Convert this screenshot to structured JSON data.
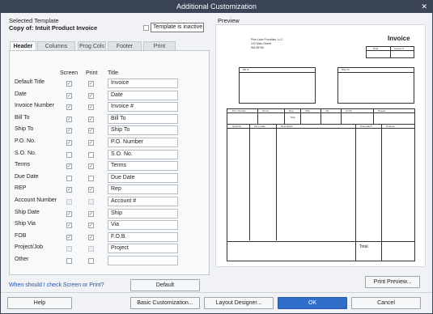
{
  "window": {
    "title": "Additional Customization"
  },
  "template": {
    "selected_label": "Selected Template",
    "copy_of": "Copy of: Intuit Product Invoice",
    "inactive_label": "Template is inactive"
  },
  "tabs": [
    "Header",
    "Columns",
    "Prog Cols",
    "Footer",
    "Print"
  ],
  "columns": {
    "screen": "Screen",
    "print": "Print",
    "title": "Title"
  },
  "rows": [
    {
      "label": "Default Title",
      "screen": true,
      "print": true,
      "title": "Invoice",
      "screen_disabled": false
    },
    {
      "label": "Date",
      "screen": true,
      "print": true,
      "title": "Date",
      "screen_disabled": false
    },
    {
      "label": "Invoice Number",
      "screen": true,
      "print": true,
      "title": "Invoice #",
      "screen_disabled": false
    },
    {
      "label": "Bill To",
      "screen": true,
      "print": true,
      "title": "Bill To",
      "screen_disabled": false
    },
    {
      "label": "Ship To",
      "screen": true,
      "print": true,
      "title": "Ship To",
      "screen_disabled": false
    },
    {
      "label": "P.O. No.",
      "screen": true,
      "print": true,
      "title": "P.O. Number",
      "screen_disabled": false
    },
    {
      "label": "S.O. No.",
      "screen": false,
      "print": false,
      "title": "S.O. No.",
      "screen_disabled": false
    },
    {
      "label": "Terms",
      "screen": true,
      "print": true,
      "title": "Terms",
      "screen_disabled": false
    },
    {
      "label": "Due Date",
      "screen": false,
      "print": false,
      "title": "Due Date",
      "screen_disabled": false
    },
    {
      "label": "REP",
      "screen": true,
      "print": true,
      "title": "Rep",
      "screen_disabled": false
    },
    {
      "label": "Account Number",
      "screen": false,
      "print": false,
      "title": "Account #",
      "screen_disabled": true
    },
    {
      "label": "Ship Date",
      "screen": true,
      "print": true,
      "title": "Ship",
      "screen_disabled": false
    },
    {
      "label": "Ship Via",
      "screen": true,
      "print": true,
      "title": "Via",
      "screen_disabled": false
    },
    {
      "label": "FOB",
      "screen": true,
      "print": true,
      "title": "F.O.B.",
      "screen_disabled": false
    },
    {
      "label": "Project/Job",
      "screen": false,
      "print": false,
      "title": "Project",
      "screen_disabled": true
    },
    {
      "label": "Other",
      "screen": false,
      "print": false,
      "title": "",
      "screen_disabled": false
    }
  ],
  "help_link": "When should I check Screen or Print?",
  "buttons": {
    "default": "Default",
    "print_preview": "Print Preview...",
    "help": "Help",
    "basic": "Basic Customization...",
    "layout": "Layout Designer...",
    "ok": "OK",
    "cancel": "Cancel"
  },
  "preview": {
    "label": "Preview",
    "company": [
      "Pine Lake Porcelain, LLC",
      "123 Main Street",
      "WA 98765"
    ],
    "doc_title": "Invoice",
    "date_hdr": [
      "Date",
      "Invoice #"
    ],
    "bill_to": "Bill To",
    "ship_to": "Ship To",
    "po_row": [
      "P.O. Number",
      "Terms",
      "Rep",
      "Ship",
      "Via",
      "F.O.B.",
      "Project"
    ],
    "ship_label": "Ship",
    "items_hdr": [
      "Quantity",
      "Item Code",
      "Description",
      "Price Each",
      "Amount"
    ],
    "total": "Total"
  },
  "colors": {
    "titlebar": "#3b4454",
    "ok": "#2f6fc9",
    "link": "#2356a8"
  }
}
